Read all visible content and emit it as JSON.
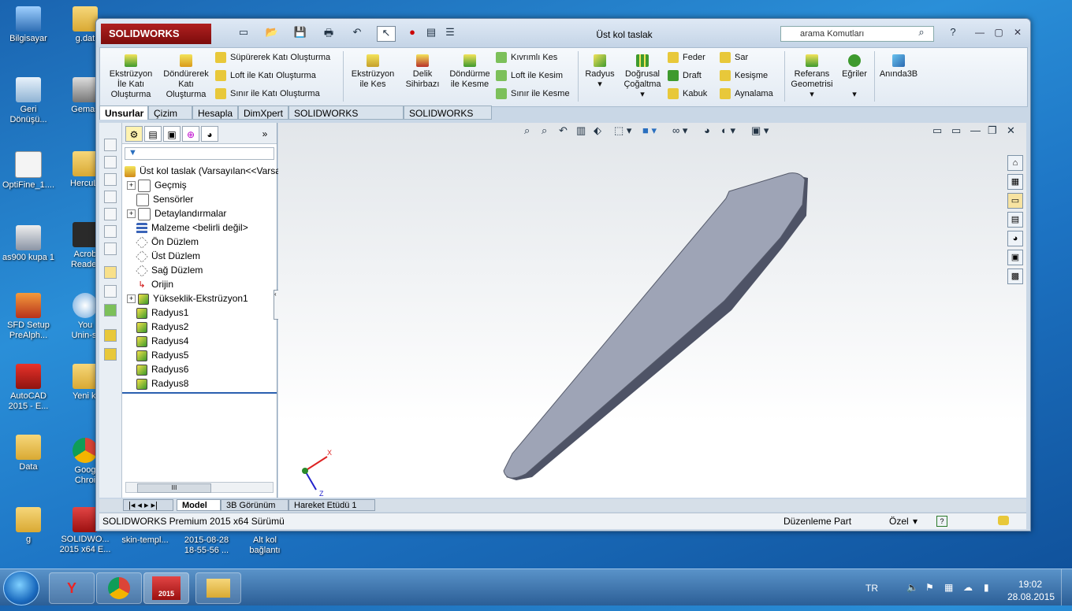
{
  "desktop": {
    "icons": [
      {
        "label": "Bilgisayar",
        "line2": ""
      },
      {
        "label": "g.dat",
        "line2": ""
      },
      {
        "label": "Geri",
        "line2": "Dönüşü..."
      },
      {
        "label": "Gemas",
        "line2": ""
      },
      {
        "label": "OptiFine_1....",
        "line2": ""
      },
      {
        "label": "HercuLi",
        "line2": ""
      },
      {
        "label": "as900 kupa 1",
        "line2": ""
      },
      {
        "label": "Acrob",
        "line2": "Reader"
      },
      {
        "label": "SFD Setup",
        "line2": "PreAlph..."
      },
      {
        "label": "You",
        "line2": "Unin-st"
      },
      {
        "label": "AutoCAD",
        "line2": "2015 - E..."
      },
      {
        "label": "Yeni kl",
        "line2": ""
      },
      {
        "label": "Data",
        "line2": ""
      },
      {
        "label": "Goog",
        "line2": "Chroi"
      },
      {
        "label": "g",
        "line2": ""
      },
      {
        "label": "SOLIDWO...",
        "line2": "2015 x64 E..."
      },
      {
        "label": "skin-templ...",
        "line2": ""
      },
      {
        "label": "2015-08-28",
        "line2": "18-55-56 ..."
      },
      {
        "label": "Alt kol",
        "line2": "bağlantı"
      }
    ]
  },
  "window": {
    "logo": "SOLIDWORKS",
    "title": "Üst kol taslak",
    "search_placeholder": "arama Komutları",
    "help": "?"
  },
  "ribbon": {
    "big": [
      {
        "l1": "Ekstrüzyon",
        "l2": "İle Katı",
        "l3": "Oluşturma"
      },
      {
        "l1": "Döndürerek",
        "l2": "Katı",
        "l3": "Oluşturma"
      },
      {
        "l1": "Ekstrüzyon",
        "l2": "ile Kes",
        "l3": ""
      },
      {
        "l1": "Delik",
        "l2": "Sihirbazı",
        "l3": ""
      },
      {
        "l1": "Döndürme",
        "l2": "ile Kesme",
        "l3": ""
      },
      {
        "l1": "Radyus",
        "l2": "",
        "l3": ""
      },
      {
        "l1": "Doğrusal",
        "l2": "Çoğaltma",
        "l3": ""
      },
      {
        "l1": "Referans",
        "l2": "Geometrisi",
        "l3": ""
      },
      {
        "l1": "Eğriler",
        "l2": "",
        "l3": ""
      },
      {
        "l1": "Anında3B",
        "l2": "",
        "l3": ""
      }
    ],
    "small": [
      "Süpürerek Katı Oluşturma",
      "Loft ile Katı Oluşturma",
      "Sınır ile Katı Oluşturma",
      "Kıvrımlı Kes",
      "Loft ile Kesim",
      "Sınır ile Kesme",
      "Feder",
      "Draft",
      "Kabuk",
      "Sar",
      "Kesişme",
      "Aynalama"
    ]
  },
  "tabs": [
    "Unsurlar",
    "Çizim",
    "Hesapla",
    "DimXpert",
    "SOLIDWORKS Eklentileri",
    "SOLIDWORKS MBD"
  ],
  "tree": {
    "root": "Üst kol taslak  (Varsayılan<<Varsa",
    "items": [
      "Geçmiş",
      "Sensörler",
      "Detaylandırmalar",
      "Malzeme <belirli değil>",
      "Ön Düzlem",
      "Üst Düzlem",
      "Sağ Düzlem",
      "Orijin",
      "Yükseklik-Ekstrüzyon1",
      "Radyus1",
      "Radyus2",
      "Radyus4",
      "Radyus5",
      "Radyus6",
      "Radyus8"
    ],
    "scroll_label": "III"
  },
  "bottom_tabs": [
    "Model",
    "3B Görünüm",
    "Hareket Etüdü 1"
  ],
  "status": {
    "left": "SOLIDWORKS Premium 2015 x64 Sürümü",
    "mode": "Düzenleme Part",
    "units": "Özel"
  },
  "axis": {
    "x": "X",
    "y": "Y",
    "z": "Z"
  },
  "taskbar": {
    "lang": "TR",
    "time": "19:02",
    "date": "28.08.2015",
    "sw_badge": "2015"
  },
  "colors": {
    "part": "#9ea4b6",
    "part_dark": "#4e5366",
    "accent": "#b41e1e"
  }
}
